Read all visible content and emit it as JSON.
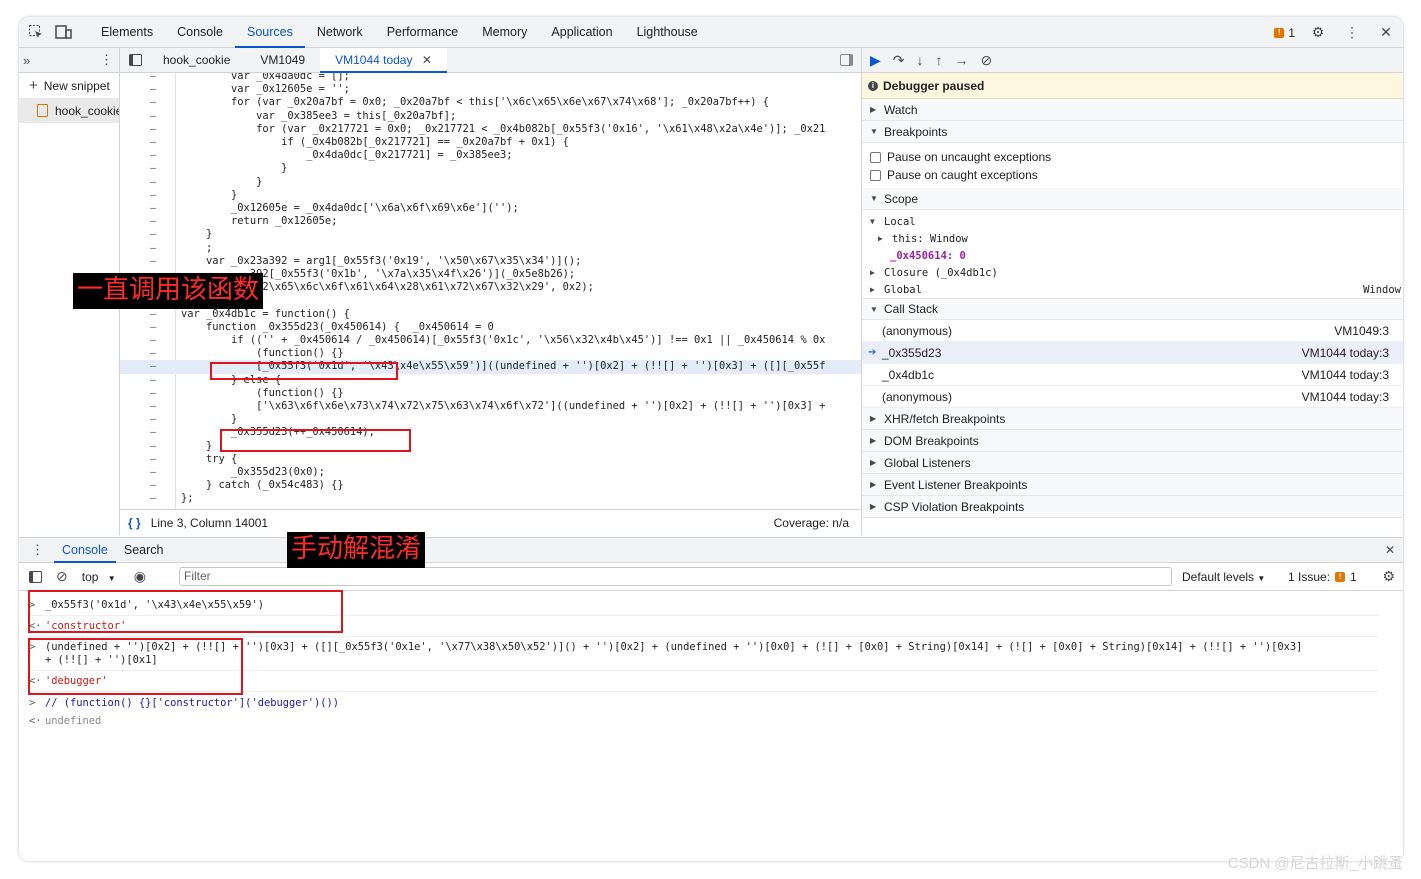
{
  "topbar": {
    "tabs": [
      "Elements",
      "Console",
      "Sources",
      "Network",
      "Performance",
      "Memory",
      "Application",
      "Lighthouse"
    ],
    "active_tab": "Sources",
    "issue_count": "1"
  },
  "navigator": {
    "new_snippet": "New snippet",
    "file": "hook_cookie"
  },
  "editor": {
    "tabs": [
      "hook_cookie",
      "VM1049",
      "VM1044 today"
    ],
    "active_tab": "VM1044 today",
    "lines": [
      "        var _0x4da0dc = [];",
      "        var _0x12605e = '';",
      "        for (var _0x20a7bf = 0x0; _0x20a7bf < this['\\x6c\\x65\\x6e\\x67\\x74\\x68']; _0x20a7bf++) {",
      "            var _0x385ee3 = this[_0x20a7bf];",
      "            for (var _0x217721 = 0x0; _0x217721 < _0x4b082b[_0x55f3('0x16', '\\x61\\x48\\x2a\\x4e')]; _0x21",
      "                if (_0x4b082b[_0x217721] == _0x20a7bf + 0x1) {",
      "                    _0x4da0dc[_0x217721] = _0x385ee3;",
      "                }",
      "            }",
      "        }",
      "        _0x12605e = _0x4da0dc['\\x6a\\x6f\\x69\\x6e']('');",
      "        return _0x12605e;",
      "    }",
      "    ;",
      "    var _0x23a392 = arg1[_0x55f3('0x19', '\\x50\\x67\\x35\\x34')]();",
      "           392[_0x55f3('0x1b', '\\x7a\\x35\\x4f\\x26')](_0x5e8b26);",
      "           x72\\x65\\x6c\\x6f\\x61\\x64\\x28\\x61\\x72\\x67\\x32\\x29', 0x2);",
      "",
      "var _0x4db1c = function() {",
      "    function _0x355d23(_0x450614) {  _0x450614 = 0",
      "        if (('' + _0x450614 / _0x450614)[_0x55f3('0x1c', '\\x56\\x32\\x4b\\x45')] !== 0x1 || _0x450614 % 0x",
      "            (function() {}",
      "            [_0x55f3('0x1d', '\\x43\\x4e\\x55\\x59')]((undefined + '')[0x2] + (!![] + '')[0x3] + ([][_0x55f",
      "        } else {",
      "            (function() {}",
      "            ['\\x63\\x6f\\x6e\\x73\\x74\\x72\\x75\\x63\\x74\\x6f\\x72']((undefined + '')[0x2] + (!![] + '')[0x3] +",
      "        }",
      "        _0x355d23(++_0x450614);",
      "    }",
      "    try {",
      "        _0x355d23(0x0);",
      "    } catch (_0x54c483) {}",
      "};"
    ],
    "status_position": "Line 3, Column 14001",
    "coverage": "Coverage: n/a"
  },
  "debugger": {
    "paused": "Debugger paused",
    "watch": "Watch",
    "breakpoints": "Breakpoints",
    "pause_uncaught": "Pause on uncaught exceptions",
    "pause_caught": "Pause on caught exceptions",
    "scope": "Scope",
    "local": "Local",
    "this_label": "this: Window",
    "var_label": "_0x450614: 0",
    "closure": "Closure (_0x4db1c)",
    "global": "Global",
    "global_value": "Window",
    "call_stack": "Call Stack",
    "frames": [
      {
        "name": "(anonymous)",
        "loc": "VM1049:3"
      },
      {
        "name": "_0x355d23",
        "loc": "VM1044 today:3"
      },
      {
        "name": "_0x4db1c",
        "loc": "VM1044 today:3"
      },
      {
        "name": "(anonymous)",
        "loc": "VM1044 today:3"
      }
    ],
    "more_sections": [
      "XHR/fetch Breakpoints",
      "DOM Breakpoints",
      "Global Listeners",
      "Event Listener Breakpoints",
      "CSP Violation Breakpoints"
    ]
  },
  "drawer": {
    "tabs": [
      "Console",
      "Search"
    ],
    "context": "top",
    "filter_placeholder": "Filter",
    "levels": "Default levels",
    "issues_label": "1 Issue:",
    "issues_count": "1"
  },
  "console": {
    "in1": "_0x55f3('0x1d', '\\x43\\x4e\\x55\\x59')",
    "out1": "'constructor'",
    "in2a": "(undefined + '')[0x2] + (!![] + '')[0x3] + ([][_0x55f3('0x1e', '\\x77\\x38\\x50\\x52')]() + '')[0x2] + (undefined + '')[0x0] + (![] + [0x0] + String)[0x14] + (![] + [0x0] + String)[0x14] + (!![] + '')[0x3]",
    "in2b": "+ (!![] + '')[0x1]",
    "out2": "'debugger'",
    "in3": "// (function() {}['constructor']('debugger')())",
    "out3": "undefined"
  },
  "annotations": {
    "label1": "一直调用该函数",
    "label2": "手动解混淆"
  },
  "watermark": "CSDN @尼古拉斯_小跳蚤"
}
